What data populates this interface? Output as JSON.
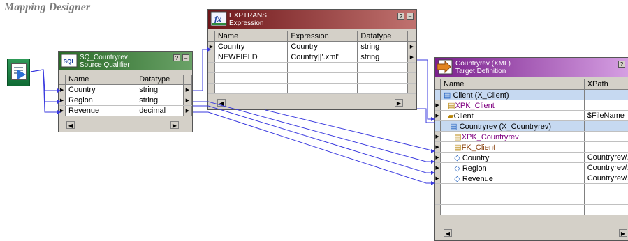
{
  "app_title": "Mapping Designer",
  "source_qualifier": {
    "name": "SQ_Countryrev",
    "subtitle": "Source Qualifier",
    "col_name": "Name",
    "col_datatype": "Datatype",
    "rows": [
      {
        "name": "Country",
        "datatype": "string"
      },
      {
        "name": "Region",
        "datatype": "string"
      },
      {
        "name": "Revenue",
        "datatype": "decimal"
      }
    ]
  },
  "expression": {
    "name": "EXPTRANS",
    "subtitle": "Expression",
    "col_name": "Name",
    "col_expression": "Expression",
    "col_datatype": "Datatype",
    "rows": [
      {
        "name": "Country",
        "expression": "Country",
        "datatype": "string"
      },
      {
        "name": "NEWFIELD",
        "expression": "Country||'.xml'",
        "datatype": "string"
      }
    ]
  },
  "target": {
    "name": "Countryrev (XML)",
    "subtitle": "Target Definition",
    "col_name": "Name",
    "col_xpath": "XPath",
    "rows": [
      {
        "name": "Client    (X_Client)",
        "xpath": ""
      },
      {
        "name": "XPK_Client",
        "xpath": ""
      },
      {
        "name": "Client",
        "xpath": "$FileName"
      },
      {
        "name": "Countryrev    (X_Countryrev)",
        "xpath": ""
      },
      {
        "name": "XPK_Countryrev",
        "xpath": ""
      },
      {
        "name": "FK_Client",
        "xpath": ""
      },
      {
        "name": "Country",
        "xpath": "Countryrev/."
      },
      {
        "name": "Region",
        "xpath": "Countryrev/."
      },
      {
        "name": "Revenue",
        "xpath": "Countryrev/."
      }
    ]
  },
  "colors": {
    "link": "#3a3adf",
    "sq_header": "#3c7d3a",
    "exp_header": "#7b1f22",
    "target_header": "#7a1f8c",
    "highlight_row": "#c6d9f1"
  },
  "icons": [
    "source-definition-icon",
    "sql-icon",
    "fx-icon",
    "target-definition-icon",
    "key-icon",
    "folder-icon",
    "port-icon"
  ]
}
